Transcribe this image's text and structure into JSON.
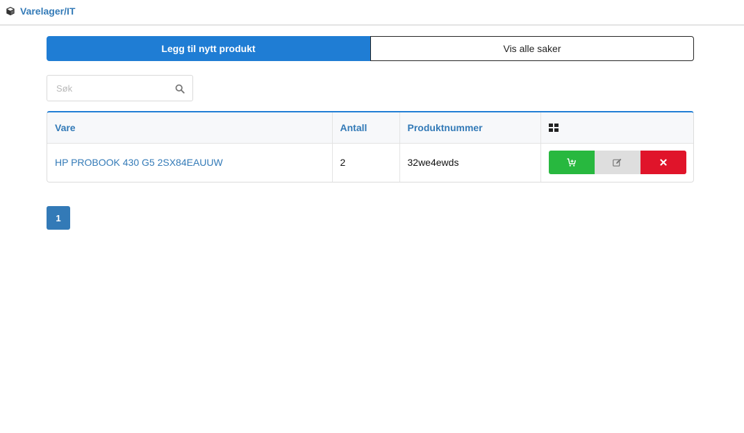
{
  "breadcrumb": {
    "icon": "cube-icon",
    "root": "Varelager",
    "separator": "/",
    "current": "IT"
  },
  "toolbar": {
    "add_product_label": "Legg til nytt produkt",
    "show_all_label": "Vis alle saker"
  },
  "search": {
    "placeholder": "Søk",
    "value": "",
    "icon": "search-icon"
  },
  "table": {
    "columns": [
      "Vare",
      "Antall",
      "Produktnummer"
    ],
    "actions_header_icon": "grid-icon",
    "rows": [
      {
        "vare": "HP PROBOOK 430 G5 2SX84EAUUW",
        "antall": "2",
        "produktnummer": "32we4ewds",
        "actions": [
          "cart-plus-icon",
          "edit-icon",
          "close-icon"
        ]
      }
    ]
  },
  "pagination": {
    "current_page": "1"
  },
  "colors": {
    "primary": "#1f7dd4",
    "link": "#337ab7",
    "success": "#28b83f",
    "danger": "#e0142a",
    "neutral": "#dedede"
  }
}
